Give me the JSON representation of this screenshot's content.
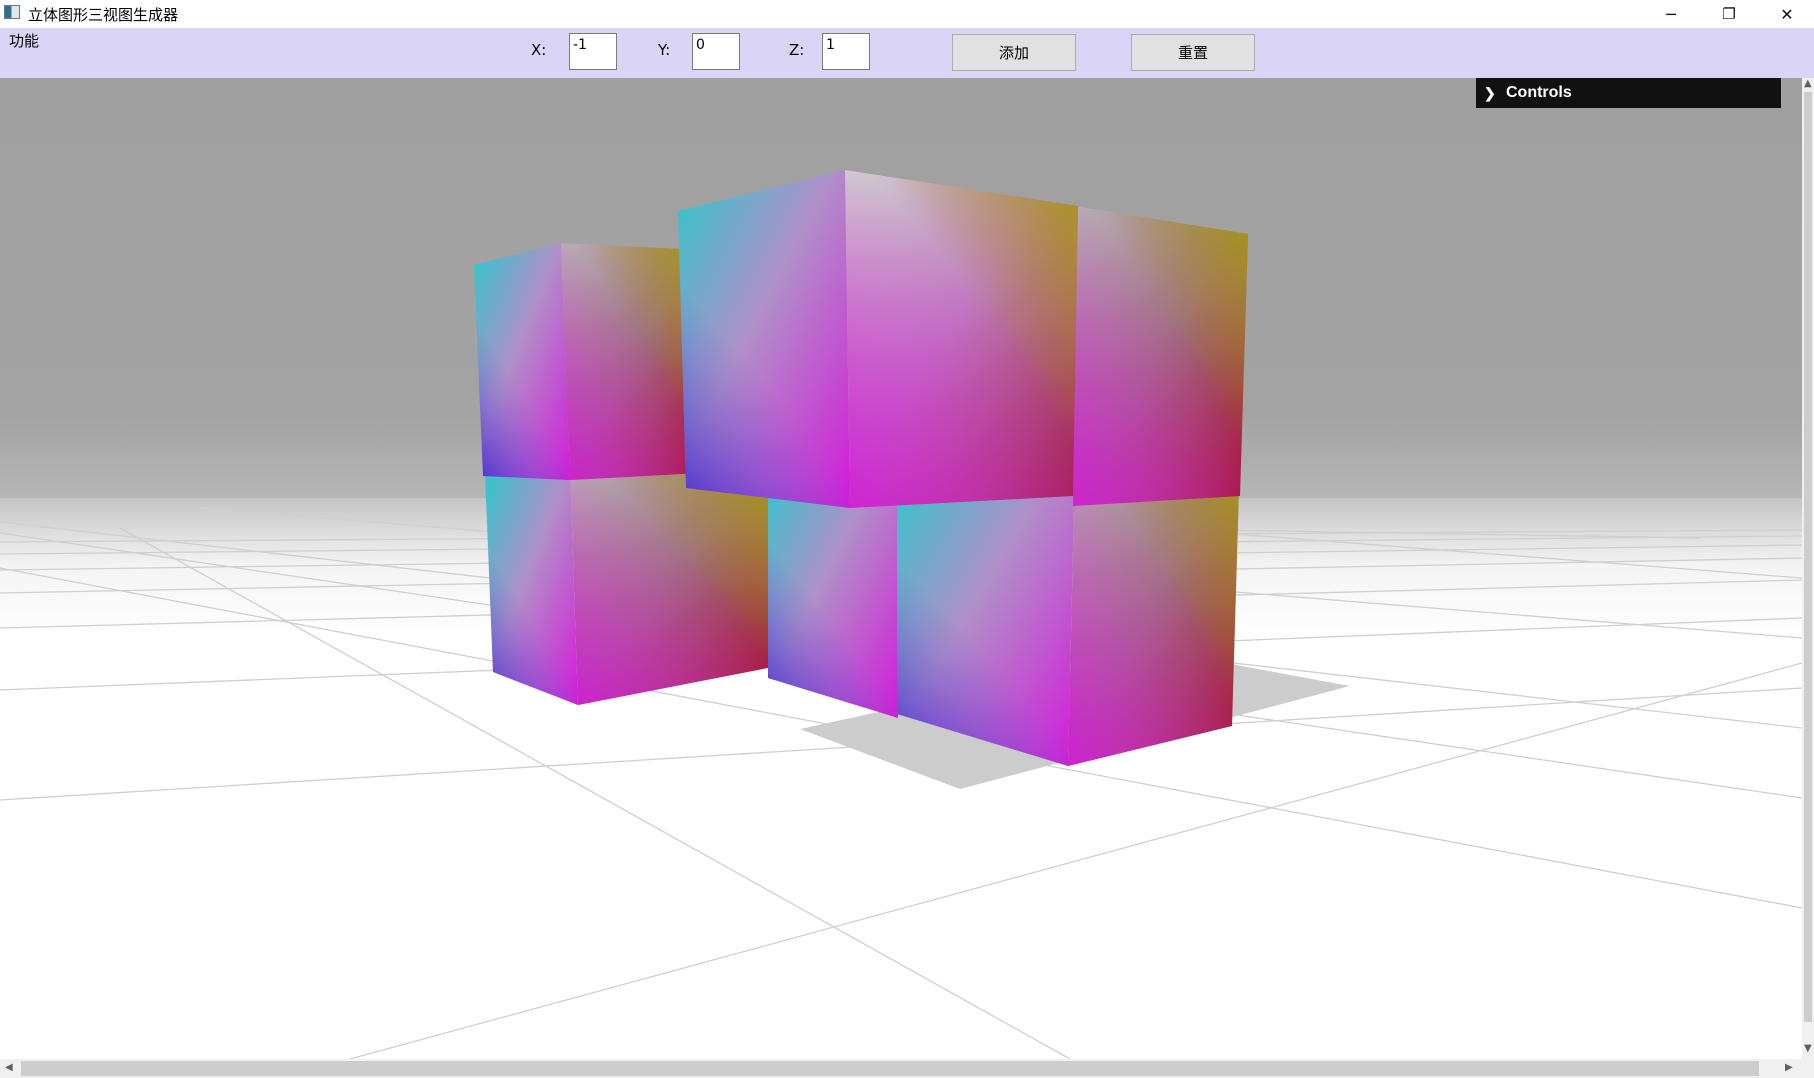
{
  "window": {
    "title": "立体图形三视图生成器",
    "controls": {
      "minimize": "─",
      "maximize": "❐",
      "close": "✕"
    }
  },
  "toolbar": {
    "menu_label": "功能",
    "x_label": "X:",
    "x_value": "-1",
    "y_label": "Y:",
    "y_value": "0",
    "z_label": "Z:",
    "z_value": "1",
    "add_label": "添加",
    "reset_label": "重置",
    "background": "#dad5f6"
  },
  "viewport": {
    "controls_label": "Controls",
    "controls_icon": "chevron-right-icon",
    "sky_color": "#a0a0a0",
    "floor_color": "#ffffff"
  },
  "scrollbars": {
    "up_arrow": "▲",
    "down_arrow": "▼",
    "left_arrow": "◀",
    "right_arrow": "▶"
  }
}
